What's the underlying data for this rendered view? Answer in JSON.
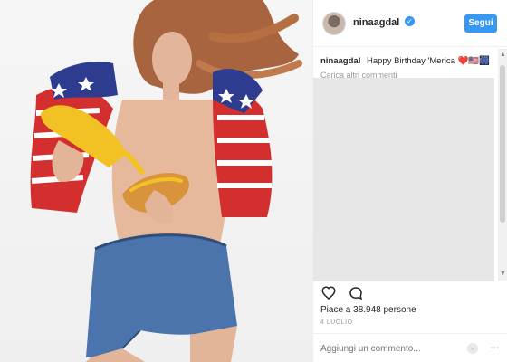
{
  "post": {
    "username": "ninaagdal",
    "follow_label": "Segui",
    "caption_text": "Happy Birthday 'Merica ❤️🇺🇸🎆",
    "load_more_label": "Carica altri commenti",
    "likes_label": "Piace a 38.948 persone",
    "date_label": "4 LUGLIO",
    "comment_placeholder": "Aggiungi un commento..."
  },
  "icons": {
    "verified": "verified-badge-icon",
    "like": "heart-icon",
    "comment": "comment-bubble-icon",
    "more": "more-options-icon",
    "scroll_up": "scroll-up-icon",
    "scroll_down": "scroll-down-icon"
  },
  "colors": {
    "accent": "#3897f0",
    "text": "#262626",
    "muted": "#999999"
  }
}
